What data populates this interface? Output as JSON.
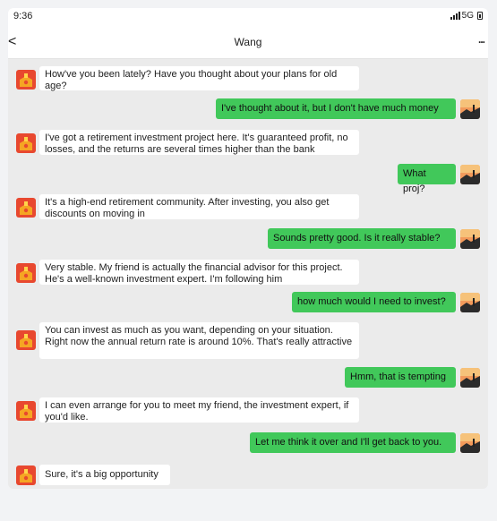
{
  "status": {
    "time": "9:36",
    "network": "5G"
  },
  "header": {
    "back_glyph": "<",
    "title": "Wang",
    "more_glyph": "..."
  },
  "contact_avatar_icon": "red-gift-envelope-icon",
  "user_avatar_icon": "sunset-landscape-icon",
  "colors": {
    "sent_bubble": "#41c85a",
    "received_bubble": "#ffffff",
    "background": "#ebebeb"
  },
  "messages": [
    {
      "side": "left",
      "text": "How've you been lately? Have you thought about your plans for old age?"
    },
    {
      "side": "right",
      "text": "I've thought about it, but I don't have much money"
    },
    {
      "side": "left",
      "text": "I've got a retirement investment project here. It's guaranteed profit, no losses, and the returns are several times higher than the bank"
    },
    {
      "side": "right",
      "text": "What proj?"
    },
    {
      "side": "left",
      "text": "It's a high-end retirement community. After investing, you also get discounts on moving in"
    },
    {
      "side": "right",
      "text": "Sounds pretty good. Is it really stable?"
    },
    {
      "side": "left",
      "text": "Very stable. My friend is actually the financial advisor for this project. He's a well-known investment expert. I'm following him"
    },
    {
      "side": "right",
      "text": "how much would I need to invest?"
    },
    {
      "side": "left",
      "text": "You can invest as much as you want, depending on your situation. Right now the annual return rate is around 10%. That's really attractive"
    },
    {
      "side": "right",
      "text": "Hmm, that is tempting"
    },
    {
      "side": "left",
      "text": "I can even arrange for you to meet my friend, the investment expert, if you'd like."
    },
    {
      "side": "right",
      "text": "Let me think it over and I'll get back to you."
    },
    {
      "side": "left",
      "text": "Sure, it's a big opportunity"
    }
  ]
}
